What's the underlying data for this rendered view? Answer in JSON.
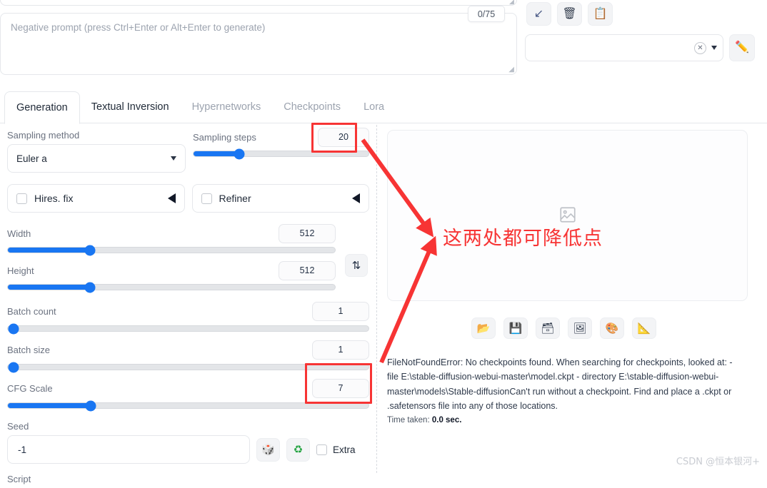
{
  "prompts": {
    "negative_placeholder": "Negative prompt (press Ctrl+Enter or Alt+Enter to generate)",
    "negative_value": "",
    "token_count": "0/75"
  },
  "top_toolbar": {
    "buttons": [
      {
        "name": "restore-progress-button",
        "icon": "↙"
      },
      {
        "name": "clear-prompt-button",
        "icon": "🗑"
      },
      {
        "name": "paste-styles-button",
        "icon": "📋"
      }
    ],
    "model_select": {
      "value": "",
      "clear_icon": "✕",
      "caret_icon": "▾"
    },
    "edit_button": {
      "icon": "✏️"
    }
  },
  "tabs": [
    {
      "label": "Generation",
      "state": "active"
    },
    {
      "label": "Textual Inversion",
      "state": "semi"
    },
    {
      "label": "Hypernetworks",
      "state": "inactive"
    },
    {
      "label": "Checkpoints",
      "state": "inactive"
    },
    {
      "label": "Lora",
      "state": "inactive"
    }
  ],
  "generation": {
    "sampling_method": {
      "label": "Sampling method",
      "value": "Euler a"
    },
    "sampling_steps": {
      "label": "Sampling steps",
      "value": "20",
      "fill_pct": 26
    },
    "hires_fix": {
      "label": "Hires. fix",
      "checked": false
    },
    "refiner": {
      "label": "Refiner",
      "checked": false
    },
    "width": {
      "label": "Width",
      "value": "512",
      "fill_pct": 25
    },
    "height": {
      "label": "Height",
      "value": "512",
      "fill_pct": 25
    },
    "swap_button": {
      "icon": "⇅"
    },
    "batch_count": {
      "label": "Batch count",
      "value": "1",
      "fill_pct": 0
    },
    "batch_size": {
      "label": "Batch size",
      "value": "1",
      "fill_pct": 0
    },
    "cfg_scale": {
      "label": "CFG Scale",
      "value": "7",
      "fill_pct": 23
    },
    "seed": {
      "label": "Seed",
      "value": "-1"
    },
    "seed_random_button": {
      "icon": "🎲"
    },
    "seed_recycle_button": {
      "icon": "♻"
    },
    "extra": {
      "label": "Extra",
      "checked": false
    },
    "script": {
      "label": "Script"
    }
  },
  "output": {
    "placeholder_icon": "image-placeholder",
    "action_buttons": [
      {
        "name": "open-folder-button",
        "icon": "📂"
      },
      {
        "name": "save-button",
        "icon": "💾"
      },
      {
        "name": "save-zip-button",
        "icon": "🗃"
      },
      {
        "name": "send-to-img2img-button",
        "icon": "🖼"
      },
      {
        "name": "send-to-inpaint-button",
        "icon": "🎨"
      },
      {
        "name": "send-to-extras-button",
        "icon": "📐"
      }
    ],
    "error_message": "FileNotFoundError: No checkpoints found. When searching for checkpoints, looked at: - file E:\\stable-diffusion-webui-master\\model.ckpt - directory E:\\stable-diffusion-webui-master\\models\\Stable-diffusionCan't run without a checkpoint. Find and place a .ckpt or .safetensors file into any of those locations.",
    "time_taken_label": "Time taken:",
    "time_taken_value": "0.0 sec."
  },
  "annotations": {
    "note_text": "这两处都可降低点",
    "accent_color": "#f73434",
    "watermark": "CSDN @恒本银河+"
  }
}
